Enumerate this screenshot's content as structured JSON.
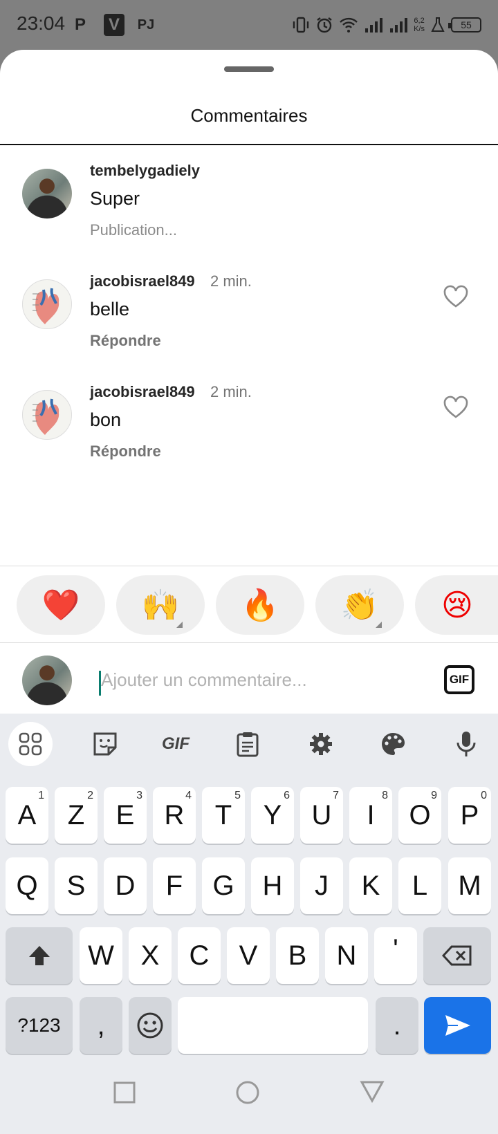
{
  "status_bar": {
    "time": "23:04",
    "apps": [
      "P",
      "V",
      "PJ"
    ],
    "net_speed": "6,2",
    "net_unit": "K/s",
    "battery": "55"
  },
  "sheet": {
    "title": "Commentaires"
  },
  "comments": [
    {
      "user": "tembelygadiely",
      "time": "",
      "text": "Super",
      "action": "Publication..."
    },
    {
      "user": "jacobisrael849",
      "time": "2 min.",
      "text": "belle",
      "action": "Répondre"
    },
    {
      "user": "jacobisrael849",
      "time": "2 min.",
      "text": "bon",
      "action": "Répondre"
    }
  ],
  "emoji_bar": [
    "❤️",
    "🙌",
    "🔥",
    "👏",
    "😢"
  ],
  "comment_input": {
    "placeholder": "Ajouter un commentaire...",
    "gif_label": "GIF"
  },
  "keyboard": {
    "toolbar": [
      "apps-grid-icon",
      "sticker-icon",
      "gif-icon",
      "clipboard-icon",
      "gear-icon",
      "palette-icon",
      "microphone-icon"
    ],
    "toolbar_gif_label": "GIF",
    "row1": [
      {
        "k": "A",
        "h": "1"
      },
      {
        "k": "Z",
        "h": "2"
      },
      {
        "k": "E",
        "h": "3"
      },
      {
        "k": "R",
        "h": "4"
      },
      {
        "k": "T",
        "h": "5"
      },
      {
        "k": "Y",
        "h": "6"
      },
      {
        "k": "U",
        "h": "7"
      },
      {
        "k": "I",
        "h": "8"
      },
      {
        "k": "O",
        "h": "9"
      },
      {
        "k": "P",
        "h": "0"
      }
    ],
    "row2": [
      "Q",
      "S",
      "D",
      "F",
      "G",
      "H",
      "J",
      "K",
      "L",
      "M"
    ],
    "row3": [
      "W",
      "X",
      "C",
      "V",
      "B",
      "N",
      "'"
    ],
    "numbers_label": "?123",
    "comma": ",",
    "period": "."
  }
}
